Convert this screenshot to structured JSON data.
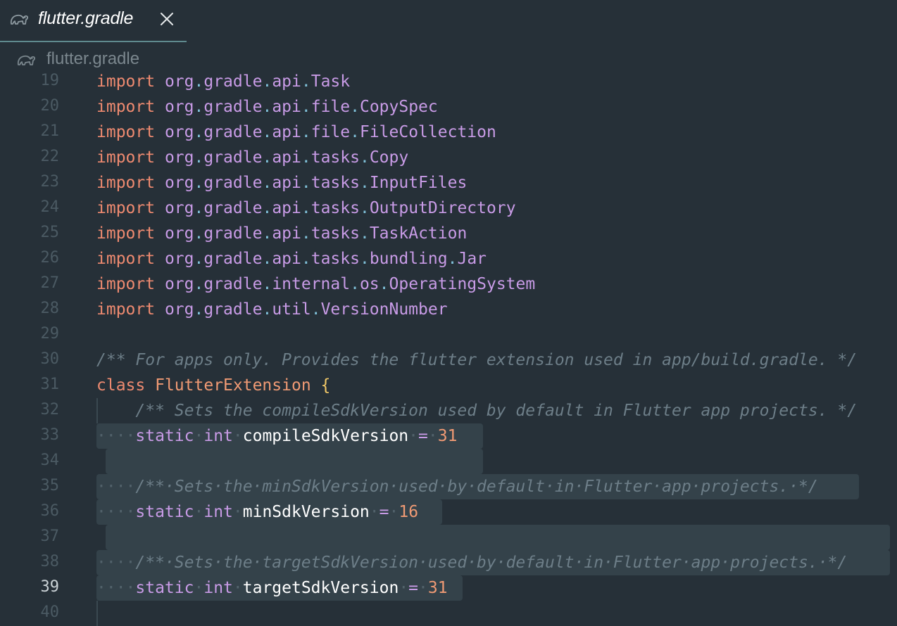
{
  "tab": {
    "title": "flutter.gradle",
    "icon": "elephant-icon"
  },
  "breadcrumb": {
    "label": "flutter.gradle"
  },
  "editor": {
    "current_line": "39",
    "lines": [
      {
        "n": "19",
        "tokens": [
          [
            "kw",
            "import"
          ],
          [
            "t",
            " "
          ],
          [
            "pkg",
            "org"
          ],
          [
            "dot",
            "."
          ],
          [
            "pkg",
            "gradle"
          ],
          [
            "dot",
            "."
          ],
          [
            "pkg",
            "api"
          ],
          [
            "dot",
            "."
          ],
          [
            "pkg",
            "Task"
          ]
        ]
      },
      {
        "n": "20",
        "tokens": [
          [
            "kw",
            "import"
          ],
          [
            "t",
            " "
          ],
          [
            "pkg",
            "org"
          ],
          [
            "dot",
            "."
          ],
          [
            "pkg",
            "gradle"
          ],
          [
            "dot",
            "."
          ],
          [
            "pkg",
            "api"
          ],
          [
            "dot",
            "."
          ],
          [
            "pkg",
            "file"
          ],
          [
            "dot",
            "."
          ],
          [
            "pkg",
            "CopySpec"
          ]
        ]
      },
      {
        "n": "21",
        "tokens": [
          [
            "kw",
            "import"
          ],
          [
            "t",
            " "
          ],
          [
            "pkg",
            "org"
          ],
          [
            "dot",
            "."
          ],
          [
            "pkg",
            "gradle"
          ],
          [
            "dot",
            "."
          ],
          [
            "pkg",
            "api"
          ],
          [
            "dot",
            "."
          ],
          [
            "pkg",
            "file"
          ],
          [
            "dot",
            "."
          ],
          [
            "pkg",
            "FileCollection"
          ]
        ]
      },
      {
        "n": "22",
        "tokens": [
          [
            "kw",
            "import"
          ],
          [
            "t",
            " "
          ],
          [
            "pkg",
            "org"
          ],
          [
            "dot",
            "."
          ],
          [
            "pkg",
            "gradle"
          ],
          [
            "dot",
            "."
          ],
          [
            "pkg",
            "api"
          ],
          [
            "dot",
            "."
          ],
          [
            "pkg",
            "tasks"
          ],
          [
            "dot",
            "."
          ],
          [
            "pkg",
            "Copy"
          ]
        ]
      },
      {
        "n": "23",
        "tokens": [
          [
            "kw",
            "import"
          ],
          [
            "t",
            " "
          ],
          [
            "pkg",
            "org"
          ],
          [
            "dot",
            "."
          ],
          [
            "pkg",
            "gradle"
          ],
          [
            "dot",
            "."
          ],
          [
            "pkg",
            "api"
          ],
          [
            "dot",
            "."
          ],
          [
            "pkg",
            "tasks"
          ],
          [
            "dot",
            "."
          ],
          [
            "pkg",
            "InputFiles"
          ]
        ]
      },
      {
        "n": "24",
        "tokens": [
          [
            "kw",
            "import"
          ],
          [
            "t",
            " "
          ],
          [
            "pkg",
            "org"
          ],
          [
            "dot",
            "."
          ],
          [
            "pkg",
            "gradle"
          ],
          [
            "dot",
            "."
          ],
          [
            "pkg",
            "api"
          ],
          [
            "dot",
            "."
          ],
          [
            "pkg",
            "tasks"
          ],
          [
            "dot",
            "."
          ],
          [
            "pkg",
            "OutputDirectory"
          ]
        ]
      },
      {
        "n": "25",
        "tokens": [
          [
            "kw",
            "import"
          ],
          [
            "t",
            " "
          ],
          [
            "pkg",
            "org"
          ],
          [
            "dot",
            "."
          ],
          [
            "pkg",
            "gradle"
          ],
          [
            "dot",
            "."
          ],
          [
            "pkg",
            "api"
          ],
          [
            "dot",
            "."
          ],
          [
            "pkg",
            "tasks"
          ],
          [
            "dot",
            "."
          ],
          [
            "pkg",
            "TaskAction"
          ]
        ]
      },
      {
        "n": "26",
        "tokens": [
          [
            "kw",
            "import"
          ],
          [
            "t",
            " "
          ],
          [
            "pkg",
            "org"
          ],
          [
            "dot",
            "."
          ],
          [
            "pkg",
            "gradle"
          ],
          [
            "dot",
            "."
          ],
          [
            "pkg",
            "api"
          ],
          [
            "dot",
            "."
          ],
          [
            "pkg",
            "tasks"
          ],
          [
            "dot",
            "."
          ],
          [
            "pkg",
            "bundling"
          ],
          [
            "dot",
            "."
          ],
          [
            "pkg",
            "Jar"
          ]
        ]
      },
      {
        "n": "27",
        "tokens": [
          [
            "kw",
            "import"
          ],
          [
            "t",
            " "
          ],
          [
            "pkg",
            "org"
          ],
          [
            "dot",
            "."
          ],
          [
            "pkg",
            "gradle"
          ],
          [
            "dot",
            "."
          ],
          [
            "pkg",
            "internal"
          ],
          [
            "dot",
            "."
          ],
          [
            "pkg",
            "os"
          ],
          [
            "dot",
            "."
          ],
          [
            "pkg",
            "OperatingSystem"
          ]
        ]
      },
      {
        "n": "28",
        "tokens": [
          [
            "kw",
            "import"
          ],
          [
            "t",
            " "
          ],
          [
            "pkg",
            "org"
          ],
          [
            "dot",
            "."
          ],
          [
            "pkg",
            "gradle"
          ],
          [
            "dot",
            "."
          ],
          [
            "pkg",
            "util"
          ],
          [
            "dot",
            "."
          ],
          [
            "pkg",
            "VersionNumber"
          ]
        ]
      },
      {
        "n": "29",
        "tokens": []
      },
      {
        "n": "30",
        "tokens": [
          [
            "cmt",
            "/** For apps only. Provides the flutter extension used in app/build.gradle. */"
          ]
        ]
      },
      {
        "n": "31",
        "tokens": [
          [
            "kw",
            "class"
          ],
          [
            "t",
            " "
          ],
          [
            "cls",
            "FlutterExtension"
          ],
          [
            "t",
            " "
          ],
          [
            "brace",
            "{"
          ]
        ]
      },
      {
        "n": "32",
        "tokens": [
          [
            "t",
            "    "
          ],
          [
            "cmt",
            "/** Sets the compileSdkVersion used by default in Flutter app projects. */"
          ]
        ]
      },
      {
        "n": "33",
        "tokens": [
          [
            "ws",
            "····"
          ],
          [
            "mod",
            "static"
          ],
          [
            "ws",
            "·"
          ],
          [
            "mod",
            "int"
          ],
          [
            "ws",
            "·"
          ],
          [
            "ident",
            "compileSdkVersion"
          ],
          [
            "ws",
            "·"
          ],
          [
            "op",
            "="
          ],
          [
            "ws",
            "·"
          ],
          [
            "num",
            "31"
          ]
        ]
      },
      {
        "n": "34",
        "tokens": []
      },
      {
        "n": "35",
        "tokens": [
          [
            "ws",
            "····"
          ],
          [
            "cmt",
            "/**·Sets·the·minSdkVersion·used·by·default·in·Flutter·app·projects.·*/"
          ]
        ]
      },
      {
        "n": "36",
        "tokens": [
          [
            "ws",
            "····"
          ],
          [
            "mod",
            "static"
          ],
          [
            "ws",
            "·"
          ],
          [
            "mod",
            "int"
          ],
          [
            "ws",
            "·"
          ],
          [
            "ident",
            "minSdkVersion"
          ],
          [
            "ws",
            "·"
          ],
          [
            "op",
            "="
          ],
          [
            "ws",
            "·"
          ],
          [
            "num",
            "16"
          ]
        ]
      },
      {
        "n": "37",
        "tokens": []
      },
      {
        "n": "38",
        "tokens": [
          [
            "ws",
            "····"
          ],
          [
            "cmt",
            "/**·Sets·the·targetSdkVersion·used·by·default·in·Flutter·app·projects.·*/"
          ]
        ]
      },
      {
        "n": "39",
        "tokens": [
          [
            "ws",
            "····"
          ],
          [
            "mod",
            "static"
          ],
          [
            "ws",
            "·"
          ],
          [
            "mod",
            "int"
          ],
          [
            "ws",
            "·"
          ],
          [
            "ident",
            "targetSdkVersion"
          ],
          [
            "ws",
            "·"
          ],
          [
            "op",
            "="
          ],
          [
            "ws",
            "·"
          ],
          [
            "num",
            "31"
          ]
        ]
      },
      {
        "n": "40",
        "tokens": []
      }
    ]
  }
}
